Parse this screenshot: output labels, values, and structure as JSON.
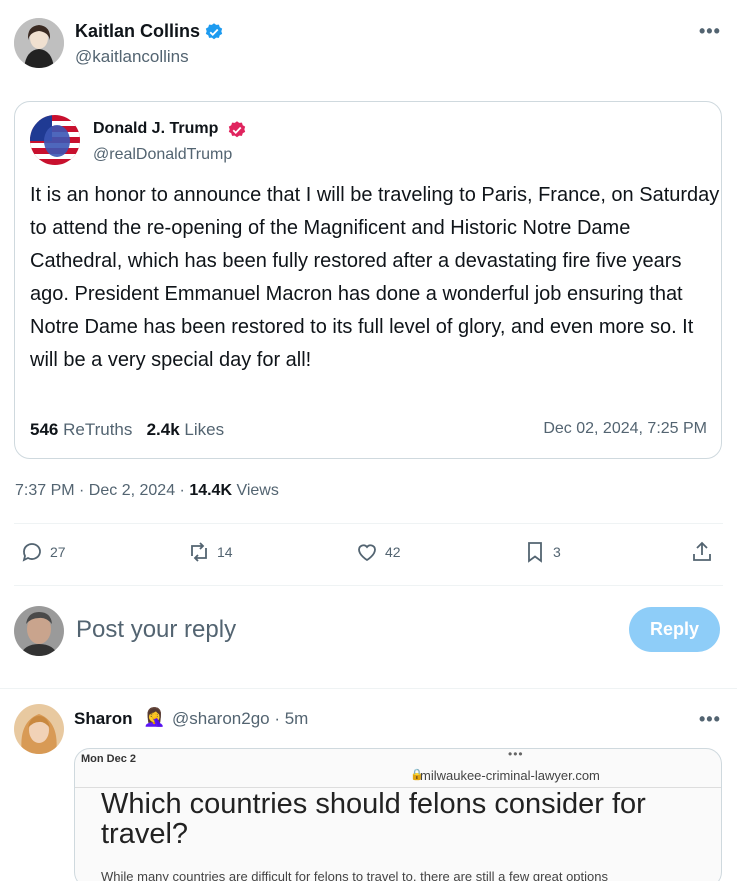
{
  "author": {
    "name": "Kaitlan Collins",
    "handle": "@kaitlancollins",
    "avatar": "portrait-avatar"
  },
  "quote": {
    "name": "Donald J. Trump",
    "handle": "@realDonaldTrump",
    "text": "It is an honor to announce that I will be traveling to Paris, France, on Saturday to attend the re-opening of the Magnificent and Historic Notre Dame Cathedral, which has been fully restored after a devastating fire five years ago. President Emmanuel Macron has done a wonderful job ensuring that Notre Dame has been restored to its full level of glory, and even more so. It will be a very special day for all!",
    "retruths_count": "546",
    "retruths_label": "ReTruths",
    "likes_count": "2.4k",
    "likes_label": "Likes",
    "date": "Dec 02, 2024, 7:25 PM"
  },
  "meta": {
    "time_date": "7:37 PM · Dec 2, 2024 · ",
    "views_count": "14.4K",
    "views_label": "Views"
  },
  "actions": {
    "replies": "27",
    "reposts": "14",
    "likes": "42",
    "bookmarks": "3"
  },
  "reply_box": {
    "placeholder": "Post your reply",
    "button_label": "Reply"
  },
  "reply": {
    "name": "Sharon",
    "emoji": "🤦‍♀️",
    "handle_time": "@sharon2go · 5m",
    "media": {
      "date": "Mon Dec 2",
      "dots": "•••",
      "url": "milwaukee-criminal-lawyer.com",
      "heading": "Which countries should felons consider for travel?",
      "body": "While many countries are difficult for felons to travel to, there are still a few great options"
    }
  },
  "colors": {
    "verified_blue": "#1d9bf0",
    "verified_red": "#e0245e",
    "reply_button": "#8ecdf8",
    "muted": "#536471"
  }
}
